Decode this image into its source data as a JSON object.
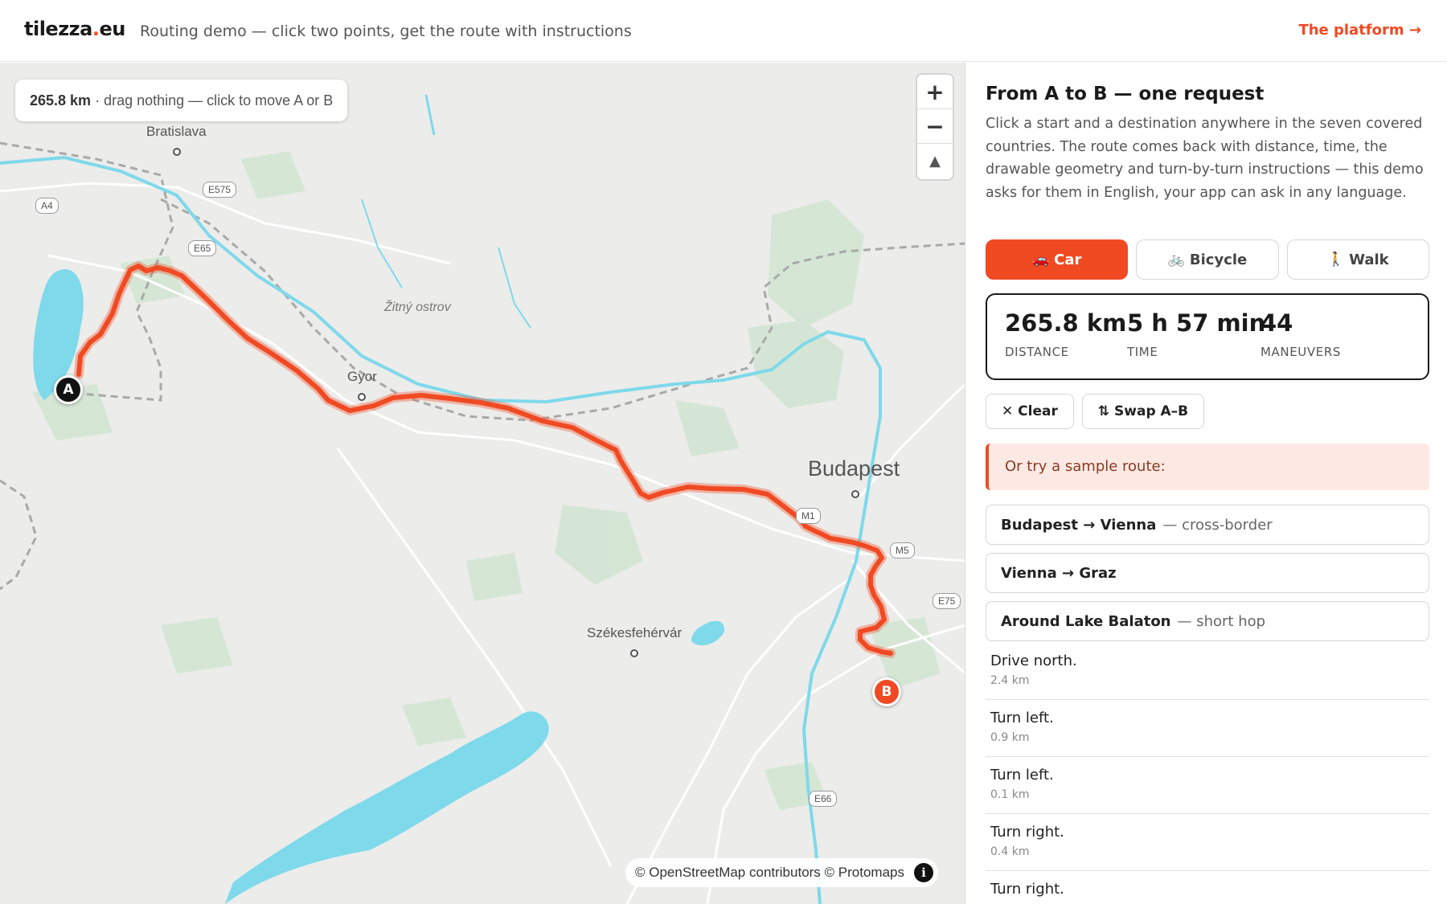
{
  "header": {
    "brand_prefix": "tilezza",
    "brand_dot": ".",
    "brand_suffix": "eu",
    "tagline": "Routing demo — click two points, get the route with instructions",
    "platform_link": "The platform →"
  },
  "map": {
    "chip_distance": "265.8 km",
    "chip_hint": "· drag nothing — click to move A or B",
    "zoom_in": "+",
    "zoom_out": "−",
    "compass": "▲",
    "attribution": "© OpenStreetMap contributors © Protomaps",
    "info": "i",
    "marker_a": "A",
    "marker_b": "B",
    "labels": {
      "bratislava": "Bratislava",
      "zitny": "Žitný ostrov",
      "gyor": "Gyor",
      "budapest": "Budapest",
      "szekesfehervar": "Székesfehérvár"
    },
    "shields": {
      "a4": "A4",
      "e575": "E575",
      "e65": "E65",
      "m5": "M5",
      "e75": "E75",
      "m1": "M1",
      "e66": "E66"
    }
  },
  "panel": {
    "title": "From A to B — one request",
    "description": "Click a start and a destination anywhere in the seven covered countries. The route comes back with distance, time, the drawable geometry and turn-by-turn instructions — this demo asks for them in English, your app can ask in any language.",
    "modes": [
      {
        "icon": "🚗",
        "label": "Car"
      },
      {
        "icon": "🚲",
        "label": "Bicycle"
      },
      {
        "icon": "🚶",
        "label": "Walk"
      }
    ],
    "stats": {
      "distance_value": "265.8 km",
      "distance_label": "DISTANCE",
      "time_value": "5 h 57 min",
      "time_label": "TIME",
      "maneuvers_value": "44",
      "maneuvers_label": "MANEUVERS"
    },
    "actions": {
      "clear": "✕ Clear",
      "swap": "⇅ Swap A–B"
    },
    "sample_prompt": "Or try a sample route:",
    "samples": [
      {
        "name": "Budapest → Vienna",
        "desc": "— cross-border"
      },
      {
        "name": "Vienna → Graz",
        "desc": ""
      },
      {
        "name": "Around Lake Balaton",
        "desc": "— short hop"
      }
    ],
    "steps": [
      {
        "text": "Drive north.",
        "dist": "2.4 km"
      },
      {
        "text": "Turn left.",
        "dist": "0.9 km"
      },
      {
        "text": "Turn left.",
        "dist": "0.1 km"
      },
      {
        "text": "Turn right.",
        "dist": "0.4 km"
      },
      {
        "text": "Turn right.",
        "dist": ""
      }
    ]
  },
  "colors": {
    "accent": "#f04a23",
    "water": "#7ed9eb",
    "park": "#cfe3cf"
  }
}
